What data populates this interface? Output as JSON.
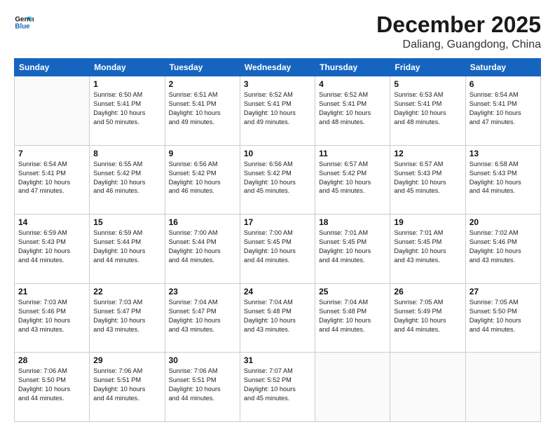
{
  "header": {
    "logo_general": "General",
    "logo_blue": "Blue",
    "month": "December 2025",
    "location": "Daliang, Guangdong, China"
  },
  "weekdays": [
    "Sunday",
    "Monday",
    "Tuesday",
    "Wednesday",
    "Thursday",
    "Friday",
    "Saturday"
  ],
  "weeks": [
    [
      {
        "day": "",
        "info": ""
      },
      {
        "day": "1",
        "info": "Sunrise: 6:50 AM\nSunset: 5:41 PM\nDaylight: 10 hours\nand 50 minutes."
      },
      {
        "day": "2",
        "info": "Sunrise: 6:51 AM\nSunset: 5:41 PM\nDaylight: 10 hours\nand 49 minutes."
      },
      {
        "day": "3",
        "info": "Sunrise: 6:52 AM\nSunset: 5:41 PM\nDaylight: 10 hours\nand 49 minutes."
      },
      {
        "day": "4",
        "info": "Sunrise: 6:52 AM\nSunset: 5:41 PM\nDaylight: 10 hours\nand 48 minutes."
      },
      {
        "day": "5",
        "info": "Sunrise: 6:53 AM\nSunset: 5:41 PM\nDaylight: 10 hours\nand 48 minutes."
      },
      {
        "day": "6",
        "info": "Sunrise: 6:54 AM\nSunset: 5:41 PM\nDaylight: 10 hours\nand 47 minutes."
      }
    ],
    [
      {
        "day": "7",
        "info": "Sunrise: 6:54 AM\nSunset: 5:41 PM\nDaylight: 10 hours\nand 47 minutes."
      },
      {
        "day": "8",
        "info": "Sunrise: 6:55 AM\nSunset: 5:42 PM\nDaylight: 10 hours\nand 46 minutes."
      },
      {
        "day": "9",
        "info": "Sunrise: 6:56 AM\nSunset: 5:42 PM\nDaylight: 10 hours\nand 46 minutes."
      },
      {
        "day": "10",
        "info": "Sunrise: 6:56 AM\nSunset: 5:42 PM\nDaylight: 10 hours\nand 45 minutes."
      },
      {
        "day": "11",
        "info": "Sunrise: 6:57 AM\nSunset: 5:42 PM\nDaylight: 10 hours\nand 45 minutes."
      },
      {
        "day": "12",
        "info": "Sunrise: 6:57 AM\nSunset: 5:43 PM\nDaylight: 10 hours\nand 45 minutes."
      },
      {
        "day": "13",
        "info": "Sunrise: 6:58 AM\nSunset: 5:43 PM\nDaylight: 10 hours\nand 44 minutes."
      }
    ],
    [
      {
        "day": "14",
        "info": "Sunrise: 6:59 AM\nSunset: 5:43 PM\nDaylight: 10 hours\nand 44 minutes."
      },
      {
        "day": "15",
        "info": "Sunrise: 6:59 AM\nSunset: 5:44 PM\nDaylight: 10 hours\nand 44 minutes."
      },
      {
        "day": "16",
        "info": "Sunrise: 7:00 AM\nSunset: 5:44 PM\nDaylight: 10 hours\nand 44 minutes."
      },
      {
        "day": "17",
        "info": "Sunrise: 7:00 AM\nSunset: 5:45 PM\nDaylight: 10 hours\nand 44 minutes."
      },
      {
        "day": "18",
        "info": "Sunrise: 7:01 AM\nSunset: 5:45 PM\nDaylight: 10 hours\nand 44 minutes."
      },
      {
        "day": "19",
        "info": "Sunrise: 7:01 AM\nSunset: 5:45 PM\nDaylight: 10 hours\nand 43 minutes."
      },
      {
        "day": "20",
        "info": "Sunrise: 7:02 AM\nSunset: 5:46 PM\nDaylight: 10 hours\nand 43 minutes."
      }
    ],
    [
      {
        "day": "21",
        "info": "Sunrise: 7:03 AM\nSunset: 5:46 PM\nDaylight: 10 hours\nand 43 minutes."
      },
      {
        "day": "22",
        "info": "Sunrise: 7:03 AM\nSunset: 5:47 PM\nDaylight: 10 hours\nand 43 minutes."
      },
      {
        "day": "23",
        "info": "Sunrise: 7:04 AM\nSunset: 5:47 PM\nDaylight: 10 hours\nand 43 minutes."
      },
      {
        "day": "24",
        "info": "Sunrise: 7:04 AM\nSunset: 5:48 PM\nDaylight: 10 hours\nand 43 minutes."
      },
      {
        "day": "25",
        "info": "Sunrise: 7:04 AM\nSunset: 5:48 PM\nDaylight: 10 hours\nand 44 minutes."
      },
      {
        "day": "26",
        "info": "Sunrise: 7:05 AM\nSunset: 5:49 PM\nDaylight: 10 hours\nand 44 minutes."
      },
      {
        "day": "27",
        "info": "Sunrise: 7:05 AM\nSunset: 5:50 PM\nDaylight: 10 hours\nand 44 minutes."
      }
    ],
    [
      {
        "day": "28",
        "info": "Sunrise: 7:06 AM\nSunset: 5:50 PM\nDaylight: 10 hours\nand 44 minutes."
      },
      {
        "day": "29",
        "info": "Sunrise: 7:06 AM\nSunset: 5:51 PM\nDaylight: 10 hours\nand 44 minutes."
      },
      {
        "day": "30",
        "info": "Sunrise: 7:06 AM\nSunset: 5:51 PM\nDaylight: 10 hours\nand 44 minutes."
      },
      {
        "day": "31",
        "info": "Sunrise: 7:07 AM\nSunset: 5:52 PM\nDaylight: 10 hours\nand 45 minutes."
      },
      {
        "day": "",
        "info": ""
      },
      {
        "day": "",
        "info": ""
      },
      {
        "day": "",
        "info": ""
      }
    ]
  ]
}
